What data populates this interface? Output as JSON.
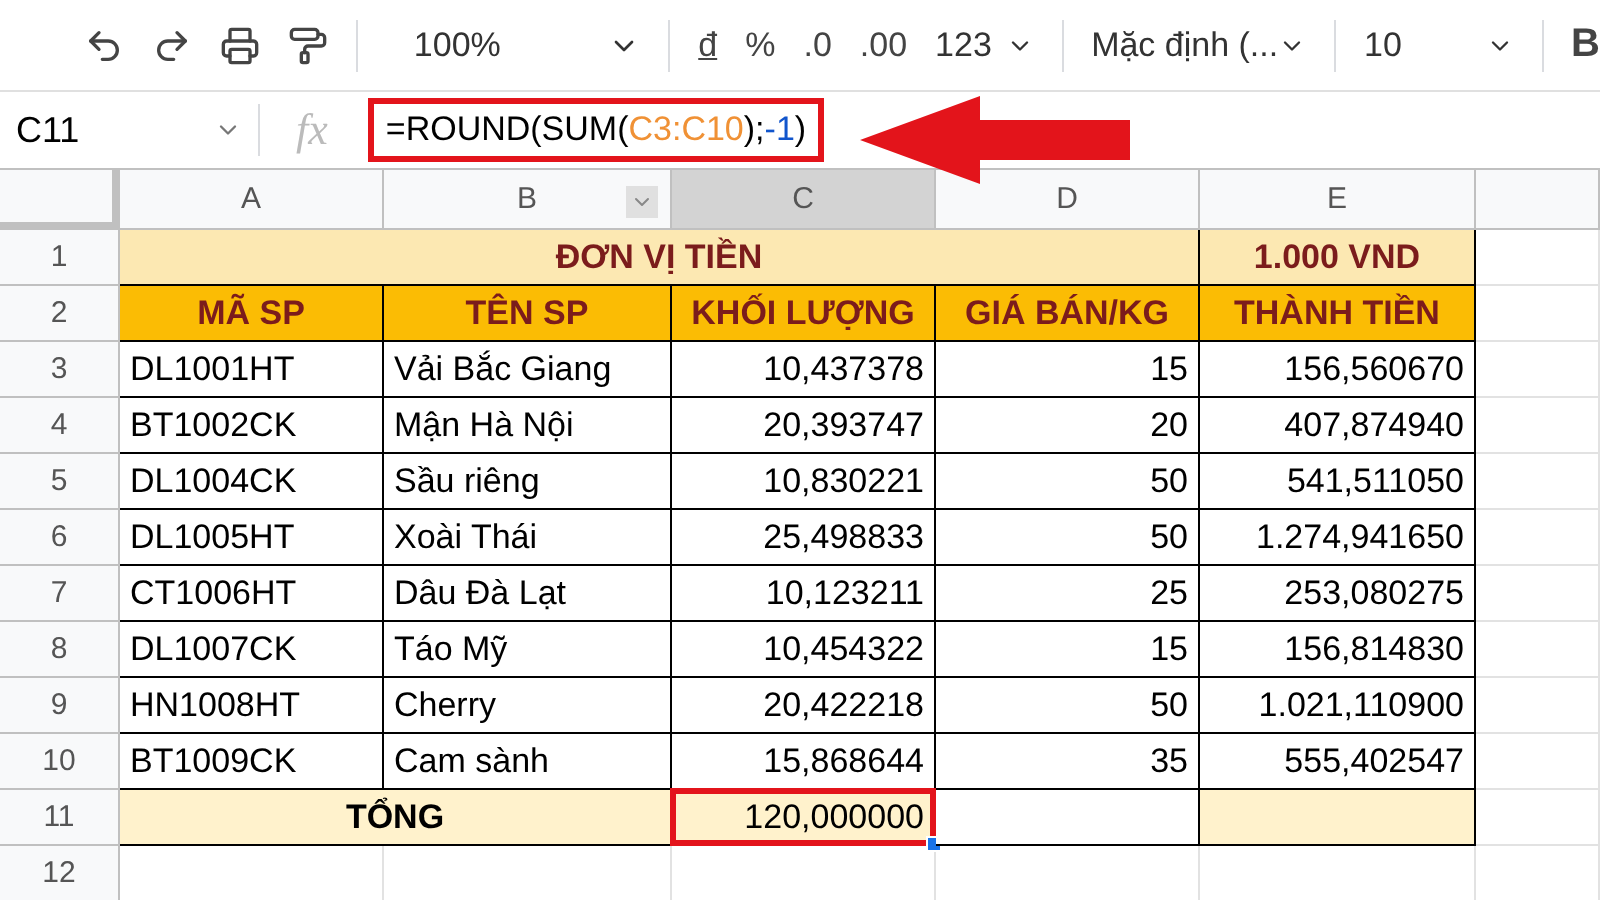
{
  "toolbar": {
    "zoom": "100%",
    "currency": "đ",
    "percent": "%",
    "decrease_decimal": ".0",
    "increase_decimal": ".00",
    "number_format": "123",
    "font": "Mặc định (...",
    "font_size": "10",
    "bold": "B"
  },
  "formula_bar": {
    "cell_ref": "C11",
    "fx": "fx",
    "annotated": true,
    "formula": [
      {
        "text": "=ROUND(SUM(",
        "kind": "plain"
      },
      {
        "text": "C3:C10",
        "kind": "range"
      },
      {
        "text": ");",
        "kind": "plain"
      },
      {
        "text": "-1",
        "kind": "number"
      },
      {
        "text": ")",
        "kind": "plain"
      }
    ]
  },
  "columns": [
    {
      "label": "A",
      "selected": false
    },
    {
      "label": "B",
      "selected": false
    },
    {
      "label": "C",
      "selected": true
    },
    {
      "label": "D",
      "selected": false
    },
    {
      "label": "E",
      "selected": false
    }
  ],
  "rows": [
    {
      "number": "1",
      "kind": "title",
      "cells": [
        "ĐƠN VỊ TIỀN",
        "1.000 VND"
      ]
    },
    {
      "number": "2",
      "kind": "header",
      "cells": [
        "MÃ SP",
        "TÊN SP",
        "KHỐI LƯỢNG",
        "GIÁ BÁN/KG",
        "THÀNH TIỀN"
      ]
    },
    {
      "number": "3",
      "kind": "data",
      "cells": [
        "DL1001HT",
        "Vải Bắc Giang",
        "10,437378",
        "15",
        "156,560670"
      ]
    },
    {
      "number": "4",
      "kind": "data",
      "cells": [
        "BT1002CK",
        "Mận Hà Nội",
        "20,393747",
        "20",
        "407,874940"
      ]
    },
    {
      "number": "5",
      "kind": "data",
      "cells": [
        "DL1004CK",
        "Sầu riêng",
        "10,830221",
        "50",
        "541,511050"
      ]
    },
    {
      "number": "6",
      "kind": "data",
      "cells": [
        "DL1005HT",
        "Xoài Thái",
        "25,498833",
        "50",
        "1.274,941650"
      ]
    },
    {
      "number": "7",
      "kind": "data",
      "cells": [
        "CT1006HT",
        "Dâu Đà Lạt",
        "10,123211",
        "25",
        "253,080275"
      ]
    },
    {
      "number": "8",
      "kind": "data",
      "cells": [
        "DL1007CK",
        "Táo Mỹ",
        "10,454322",
        "15",
        "156,814830"
      ]
    },
    {
      "number": "9",
      "kind": "data",
      "cells": [
        "HN1008HT",
        "Cherry",
        "20,422218",
        "50",
        "1.021,110900"
      ]
    },
    {
      "number": "10",
      "kind": "data",
      "cells": [
        "BT1009CK",
        "Cam sành",
        "15,868644",
        "35",
        "555,402547"
      ]
    },
    {
      "number": "11",
      "kind": "total",
      "cells": [
        "TỔNG",
        "120,000000"
      ],
      "selected": true,
      "annotated": true
    },
    {
      "number": "12",
      "kind": "empty",
      "cells": []
    }
  ]
}
